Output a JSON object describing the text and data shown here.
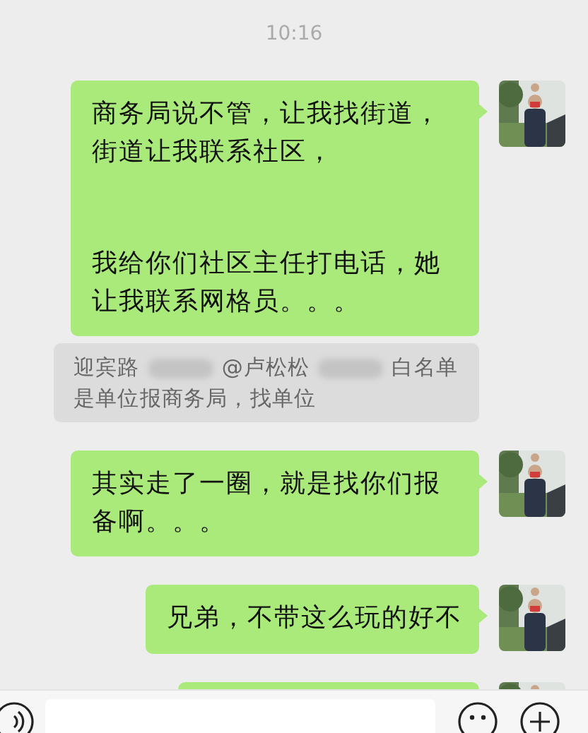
{
  "time": "10:16",
  "items": [
    {
      "kind": "message",
      "paragraphs": [
        "商务局说不管，让我找街道，街道让我联系社区，",
        "我给你们社区主任打电话，她让我联系网格员。。。"
      ]
    },
    {
      "kind": "quote",
      "parts": [
        {
          "kind": "text",
          "text": "迎宾路"
        },
        {
          "kind": "redacted"
        },
        {
          "kind": "text",
          "text": "@卢松松"
        },
        {
          "kind": "redacted"
        },
        {
          "kind": "text",
          "text": "白名单是单位报商务局，找单位"
        }
      ]
    },
    {
      "kind": "message",
      "text": "其实走了一圈，就是找你们报备啊。。。"
    },
    {
      "kind": "message",
      "text": "兄弟，不带这么玩的好不"
    },
    {
      "kind": "partial"
    }
  ]
}
